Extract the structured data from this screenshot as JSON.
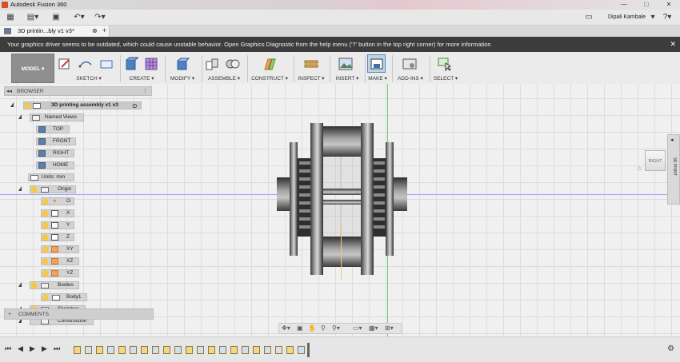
{
  "window": {
    "title": "Autodesk Fusion 360",
    "controls": [
      "—",
      "□",
      "✕"
    ]
  },
  "appbar": {
    "user": "Dipali Kambale",
    "help": "?"
  },
  "tab": {
    "label": "3D printin...bly v1 v3*",
    "close": "⊗",
    "add": "+"
  },
  "warning": {
    "message": "Your graphics driver seems to be outdated, which could cause unstable behavior. Open Graphics Diagnostic from the help menu ('?' button in the top right corner) for more information",
    "close": "✕"
  },
  "toolbar": {
    "workspace": "MODEL ▾",
    "groups": [
      {
        "label": "SKETCH ▾"
      },
      {
        "label": "CREATE ▾"
      },
      {
        "label": "MODIFY ▾"
      },
      {
        "label": "ASSEMBLE ▾"
      },
      {
        "label": "CONSTRUCT ▾"
      },
      {
        "label": "INSPECT ▾"
      },
      {
        "label": "INSERT ▾"
      },
      {
        "label": "MAKE ▾"
      },
      {
        "label": "ADD-INS ▾"
      },
      {
        "label": "SELECT ▾"
      }
    ]
  },
  "viewcube": {
    "face": "RIGHT"
  },
  "browser": {
    "header": "BROWSER",
    "root": "3D printing assembly v1 v3",
    "named_views": {
      "label": "Named Views",
      "items": [
        "TOP",
        "FRONT",
        "RIGHT",
        "HOME"
      ]
    },
    "units": "Units: mm",
    "origin": {
      "label": "Origin",
      "items": [
        "O",
        "X",
        "Y",
        "Z",
        "XY",
        "XZ",
        "YZ"
      ]
    },
    "bodies": {
      "label": "Bodies",
      "items": [
        "Body1"
      ]
    },
    "sketches": "Sketches",
    "construction": "Construction"
  },
  "comments": {
    "label": "COMMENTS",
    "plus": "+"
  },
  "right_panel": {
    "label": "3D PRINT"
  },
  "colors": {
    "warning_bg": "#3c3c3c",
    "axis_x": "#9aa0ff",
    "axis_y": "#6fd06f",
    "model_metal": "#8c8c8c"
  }
}
